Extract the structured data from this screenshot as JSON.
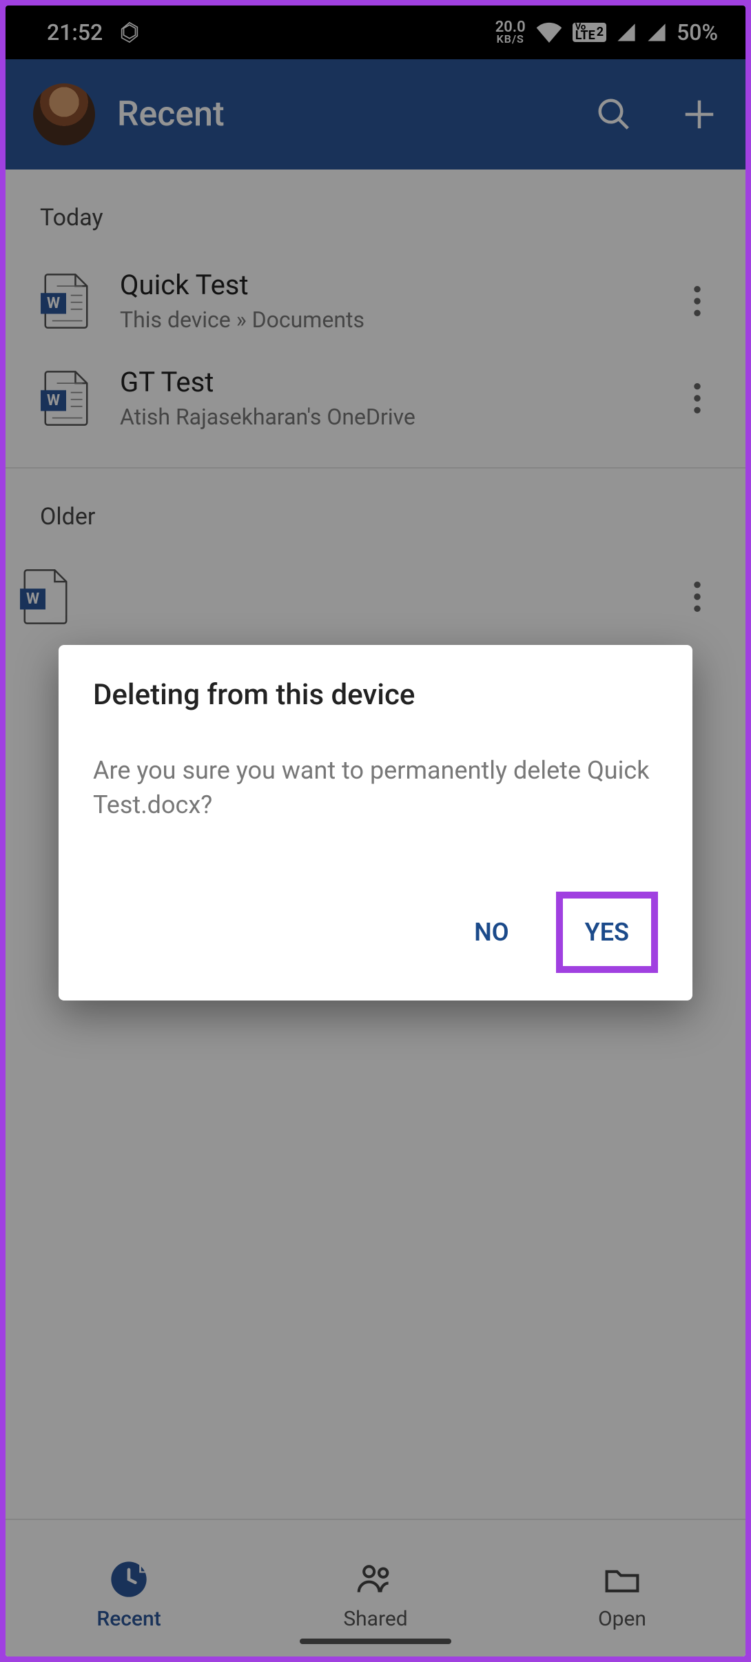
{
  "status": {
    "time": "21:52",
    "data_speed": "20.0",
    "data_unit": "KB/S",
    "volte": "LTE",
    "volte_pre": "Vo",
    "sim": "2",
    "battery": "50%"
  },
  "header": {
    "title": "Recent"
  },
  "sections": [
    {
      "label": "Today",
      "files": [
        {
          "title": "Quick Test",
          "subtitle": "This device » Documents"
        },
        {
          "title": "GT Test",
          "subtitle": "Atish Rajasekharan's OneDrive"
        }
      ]
    },
    {
      "label": "Older",
      "files": [
        {
          "title": "",
          "subtitle": ""
        }
      ]
    }
  ],
  "nav": {
    "items": [
      {
        "label": "Recent",
        "active": true
      },
      {
        "label": "Shared",
        "active": false
      },
      {
        "label": "Open",
        "active": false
      }
    ]
  },
  "dialog": {
    "title": "Deleting from this device",
    "body": "Are you sure you want to permanently delete Quick Test.docx?",
    "no": "NO",
    "yes": "YES"
  }
}
